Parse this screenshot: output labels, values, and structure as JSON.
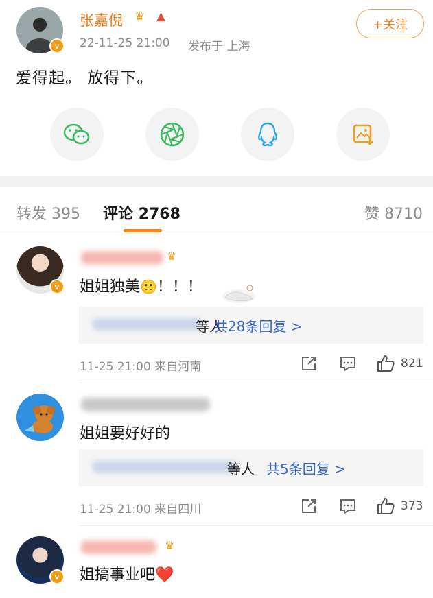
{
  "post": {
    "author": "张嘉倪",
    "time": "22-11-25 21:00",
    "location": "发布于 上海",
    "follow_label": "+关注",
    "text": "爱得起。 放得下。",
    "verified_badge": "v"
  },
  "share_icons": [
    "wechat-icon",
    "moments-icon",
    "qq-icon",
    "save-image-icon"
  ],
  "tabs": {
    "repost": "转发 395",
    "comments": "评论 2768",
    "likes": "赞 8710"
  },
  "comments": [
    {
      "text": "姐姐独美",
      "emoji": "🙁",
      "tail": "！！！",
      "reply_people": "等人",
      "reply_link": "共28条回复 >",
      "time": "11-25 21:00 来自河南",
      "likes": "821"
    },
    {
      "text": "姐姐要好好的",
      "reply_people": "等人",
      "reply_link": "共5条回复 >",
      "time": "11-25 21:00 来自四川",
      "likes": "373"
    },
    {
      "text": "姐搞事业吧",
      "emoji": "❤️"
    }
  ],
  "colors": {
    "accent": "#f27a12",
    "link": "#3b67c9",
    "muted": "#8c8c8c"
  }
}
